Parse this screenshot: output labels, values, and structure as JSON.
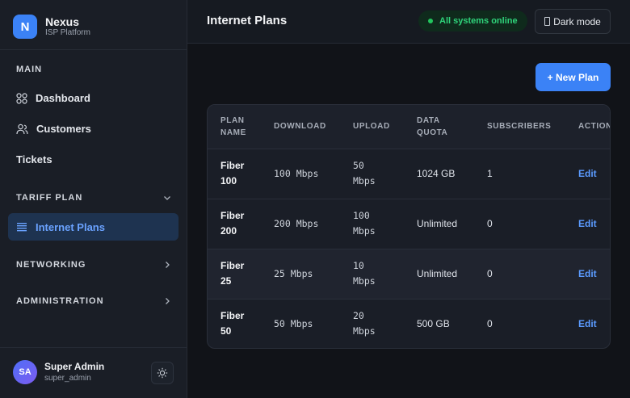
{
  "brand": {
    "logo_letter": "N",
    "name": "Nexus",
    "subtitle": "ISP Platform"
  },
  "sidebar": {
    "main_label": "MAIN",
    "items": [
      {
        "label": "Dashboard",
        "icon": "grid-icon"
      },
      {
        "label": "Customers",
        "icon": "users-icon"
      },
      {
        "label": "Tickets"
      }
    ],
    "tariff_label": "TARIFF PLAN",
    "active_item": {
      "label": "Internet Plans",
      "icon": "list-icon"
    },
    "networking_label": "NETWORKING",
    "administration_label": "ADMINISTRATION"
  },
  "user": {
    "initials": "SA",
    "name": "Super Admin",
    "handle": "super_admin"
  },
  "header": {
    "title": "Internet Plans",
    "status": "All systems online",
    "theme_button": "Dark mode"
  },
  "actions": {
    "new_plan": "+ New Plan"
  },
  "table": {
    "columns": [
      "PLAN NAME",
      "DOWNLOAD",
      "UPLOAD",
      "DATA QUOTA",
      "SUBSCRIBERS",
      "ACTIONS"
    ],
    "rows": [
      {
        "name": "Fiber 100",
        "download": "100 Mbps",
        "upload": "50 Mbps",
        "quota": "1024 GB",
        "subscribers": "1",
        "action": "Edit"
      },
      {
        "name": "Fiber 200",
        "download": "200 Mbps",
        "upload": "100 Mbps",
        "quota": "Unlimited",
        "subscribers": "0",
        "action": "Edit"
      },
      {
        "name": "Fiber 25",
        "download": "25 Mbps",
        "upload": "10 Mbps",
        "quota": "Unlimited",
        "subscribers": "0",
        "action": "Edit"
      },
      {
        "name": "Fiber 50",
        "download": "50 Mbps",
        "upload": "20 Mbps",
        "quota": "500 GB",
        "subscribers": "0",
        "action": "Edit"
      }
    ]
  },
  "colors": {
    "accent": "#3b82f6",
    "status_green": "#2fd37a",
    "background": "#111318"
  }
}
